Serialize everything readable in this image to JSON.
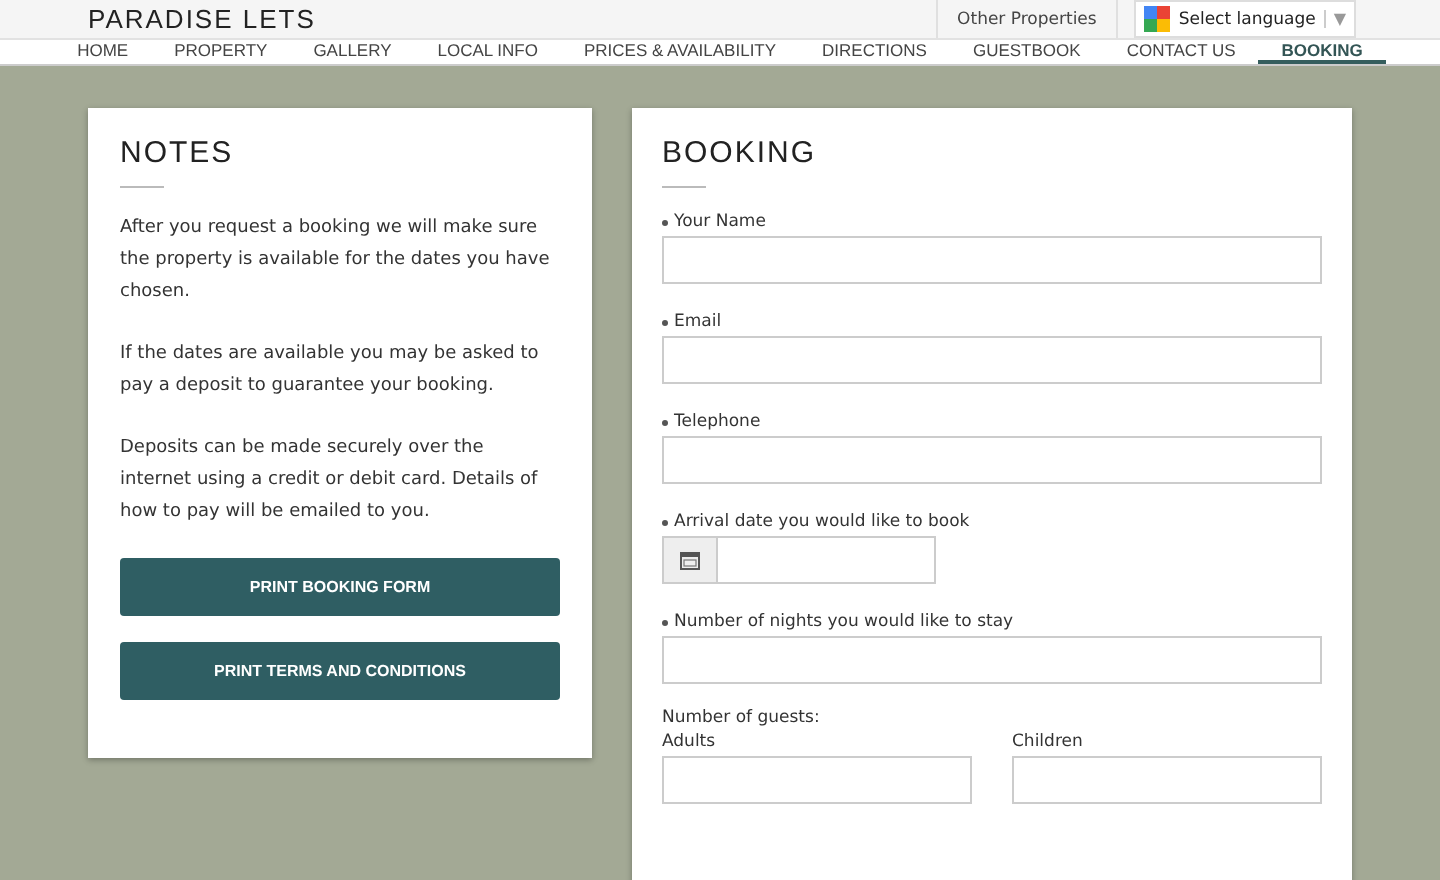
{
  "header": {
    "brand": "PARADISE LETS",
    "other_link": "Other Properties",
    "language_select": "Select language",
    "language_caret": "▼"
  },
  "nav": [
    {
      "label": "HOME",
      "selected": false
    },
    {
      "label": "PROPERTY",
      "selected": false
    },
    {
      "label": "GALLERY",
      "selected": false
    },
    {
      "label": "LOCAL INFO",
      "selected": false
    },
    {
      "label": "PRICES & AVAILABILITY",
      "selected": false
    },
    {
      "label": "DIRECTIONS",
      "selected": false
    },
    {
      "label": "GUESTBOOK",
      "selected": false
    },
    {
      "label": "CONTACT US",
      "selected": false
    },
    {
      "label": "BOOKING",
      "selected": true
    }
  ],
  "notes": {
    "title": "NOTES",
    "paragraphs": [
      "After you request a booking we will make sure the property is available for the dates you have chosen.",
      "If the dates are available you may be asked to pay a deposit to guarantee your booking.",
      "Deposits can be made securely over the internet using a credit or debit card. Details of how to pay will be emailed to you."
    ],
    "buttons": [
      "PRINT BOOKING FORM",
      "PRINT TERMS AND CONDITIONS"
    ]
  },
  "booking": {
    "title": "BOOKING",
    "fields": [
      {
        "kind": "text",
        "label": "Your Name",
        "required": true
      },
      {
        "kind": "text",
        "label": "Email",
        "required": true
      },
      {
        "kind": "text",
        "label": "Telephone",
        "required": true
      },
      {
        "kind": "date",
        "label": "Arrival date you would like to book",
        "required": true
      },
      {
        "kind": "text",
        "label": "Number of nights you would like to stay",
        "required": true
      }
    ],
    "guests": {
      "label": "Number of guests:",
      "fields": [
        {
          "label": "Adults"
        },
        {
          "label": "Children"
        }
      ]
    }
  }
}
